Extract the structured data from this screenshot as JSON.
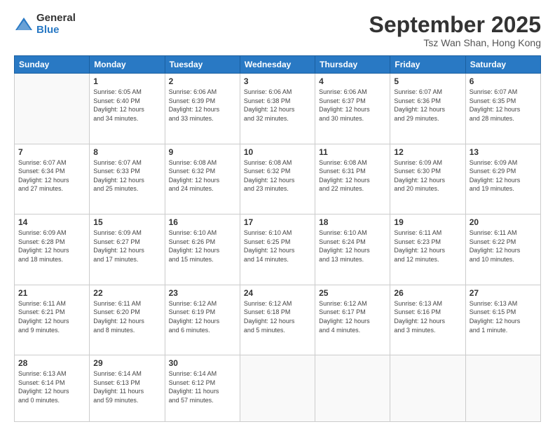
{
  "header": {
    "logo_general": "General",
    "logo_blue": "Blue",
    "month_title": "September 2025",
    "subtitle": "Tsz Wan Shan, Hong Kong"
  },
  "weekdays": [
    "Sunday",
    "Monday",
    "Tuesday",
    "Wednesday",
    "Thursday",
    "Friday",
    "Saturday"
  ],
  "weeks": [
    [
      {
        "day": "",
        "info": ""
      },
      {
        "day": "1",
        "info": "Sunrise: 6:05 AM\nSunset: 6:40 PM\nDaylight: 12 hours\nand 34 minutes."
      },
      {
        "day": "2",
        "info": "Sunrise: 6:06 AM\nSunset: 6:39 PM\nDaylight: 12 hours\nand 33 minutes."
      },
      {
        "day": "3",
        "info": "Sunrise: 6:06 AM\nSunset: 6:38 PM\nDaylight: 12 hours\nand 32 minutes."
      },
      {
        "day": "4",
        "info": "Sunrise: 6:06 AM\nSunset: 6:37 PM\nDaylight: 12 hours\nand 30 minutes."
      },
      {
        "day": "5",
        "info": "Sunrise: 6:07 AM\nSunset: 6:36 PM\nDaylight: 12 hours\nand 29 minutes."
      },
      {
        "day": "6",
        "info": "Sunrise: 6:07 AM\nSunset: 6:35 PM\nDaylight: 12 hours\nand 28 minutes."
      }
    ],
    [
      {
        "day": "7",
        "info": "Sunrise: 6:07 AM\nSunset: 6:34 PM\nDaylight: 12 hours\nand 27 minutes."
      },
      {
        "day": "8",
        "info": "Sunrise: 6:07 AM\nSunset: 6:33 PM\nDaylight: 12 hours\nand 25 minutes."
      },
      {
        "day": "9",
        "info": "Sunrise: 6:08 AM\nSunset: 6:32 PM\nDaylight: 12 hours\nand 24 minutes."
      },
      {
        "day": "10",
        "info": "Sunrise: 6:08 AM\nSunset: 6:32 PM\nDaylight: 12 hours\nand 23 minutes."
      },
      {
        "day": "11",
        "info": "Sunrise: 6:08 AM\nSunset: 6:31 PM\nDaylight: 12 hours\nand 22 minutes."
      },
      {
        "day": "12",
        "info": "Sunrise: 6:09 AM\nSunset: 6:30 PM\nDaylight: 12 hours\nand 20 minutes."
      },
      {
        "day": "13",
        "info": "Sunrise: 6:09 AM\nSunset: 6:29 PM\nDaylight: 12 hours\nand 19 minutes."
      }
    ],
    [
      {
        "day": "14",
        "info": "Sunrise: 6:09 AM\nSunset: 6:28 PM\nDaylight: 12 hours\nand 18 minutes."
      },
      {
        "day": "15",
        "info": "Sunrise: 6:09 AM\nSunset: 6:27 PM\nDaylight: 12 hours\nand 17 minutes."
      },
      {
        "day": "16",
        "info": "Sunrise: 6:10 AM\nSunset: 6:26 PM\nDaylight: 12 hours\nand 15 minutes."
      },
      {
        "day": "17",
        "info": "Sunrise: 6:10 AM\nSunset: 6:25 PM\nDaylight: 12 hours\nand 14 minutes."
      },
      {
        "day": "18",
        "info": "Sunrise: 6:10 AM\nSunset: 6:24 PM\nDaylight: 12 hours\nand 13 minutes."
      },
      {
        "day": "19",
        "info": "Sunrise: 6:11 AM\nSunset: 6:23 PM\nDaylight: 12 hours\nand 12 minutes."
      },
      {
        "day": "20",
        "info": "Sunrise: 6:11 AM\nSunset: 6:22 PM\nDaylight: 12 hours\nand 10 minutes."
      }
    ],
    [
      {
        "day": "21",
        "info": "Sunrise: 6:11 AM\nSunset: 6:21 PM\nDaylight: 12 hours\nand 9 minutes."
      },
      {
        "day": "22",
        "info": "Sunrise: 6:11 AM\nSunset: 6:20 PM\nDaylight: 12 hours\nand 8 minutes."
      },
      {
        "day": "23",
        "info": "Sunrise: 6:12 AM\nSunset: 6:19 PM\nDaylight: 12 hours\nand 6 minutes."
      },
      {
        "day": "24",
        "info": "Sunrise: 6:12 AM\nSunset: 6:18 PM\nDaylight: 12 hours\nand 5 minutes."
      },
      {
        "day": "25",
        "info": "Sunrise: 6:12 AM\nSunset: 6:17 PM\nDaylight: 12 hours\nand 4 minutes."
      },
      {
        "day": "26",
        "info": "Sunrise: 6:13 AM\nSunset: 6:16 PM\nDaylight: 12 hours\nand 3 minutes."
      },
      {
        "day": "27",
        "info": "Sunrise: 6:13 AM\nSunset: 6:15 PM\nDaylight: 12 hours\nand 1 minute."
      }
    ],
    [
      {
        "day": "28",
        "info": "Sunrise: 6:13 AM\nSunset: 6:14 PM\nDaylight: 12 hours\nand 0 minutes."
      },
      {
        "day": "29",
        "info": "Sunrise: 6:14 AM\nSunset: 6:13 PM\nDaylight: 11 hours\nand 59 minutes."
      },
      {
        "day": "30",
        "info": "Sunrise: 6:14 AM\nSunset: 6:12 PM\nDaylight: 11 hours\nand 57 minutes."
      },
      {
        "day": "",
        "info": ""
      },
      {
        "day": "",
        "info": ""
      },
      {
        "day": "",
        "info": ""
      },
      {
        "day": "",
        "info": ""
      }
    ]
  ]
}
